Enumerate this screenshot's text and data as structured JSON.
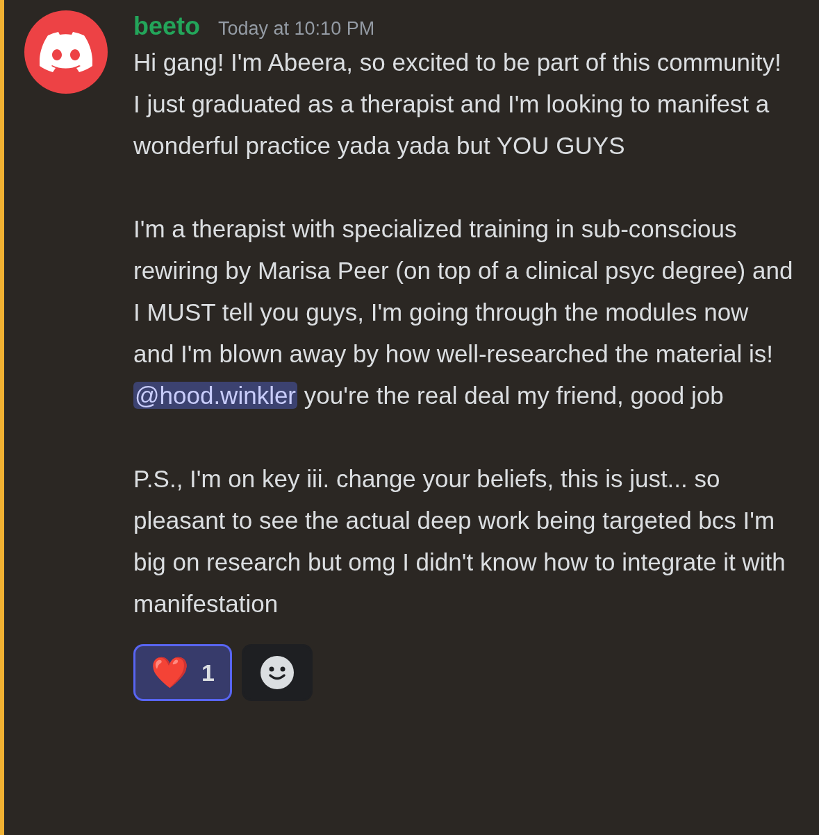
{
  "message": {
    "author": "beeto",
    "timestamp": "Today at 10:10 PM",
    "paragraphs": [
      {
        "segments": [
          {
            "kind": "text",
            "text": "Hi gang! I'm Abeera, so excited to be part of this community! I just graduated as a therapist and I'm looking to manifest a wonderful practice yada yada but YOU GUYS"
          }
        ]
      },
      {
        "segments": [
          {
            "kind": "text",
            "text": "I'm a therapist with specialized training in sub-conscious rewiring by Marisa Peer (on top of a clinical psyc degree) and I MUST tell you guys, I'm going through the modules now and I'm blown away by how well-researched the material is!"
          },
          {
            "kind": "mention",
            "text": "@hood.winkler"
          },
          {
            "kind": "text",
            "text": "you're the real deal my friend, good job"
          }
        ]
      },
      {
        "segments": [
          {
            "kind": "text",
            "text": "P.S., I'm on key iii. change your beliefs, this is just... so pleasant to see the actual deep work being targeted bcs I'm big on research but omg I didn't know how to integrate it with manifestation"
          }
        ]
      }
    ],
    "reactions": [
      {
        "kind": "emoji",
        "emoji": "❤️",
        "count": "1",
        "selected": true
      },
      {
        "kind": "add",
        "selected": false
      }
    ]
  }
}
